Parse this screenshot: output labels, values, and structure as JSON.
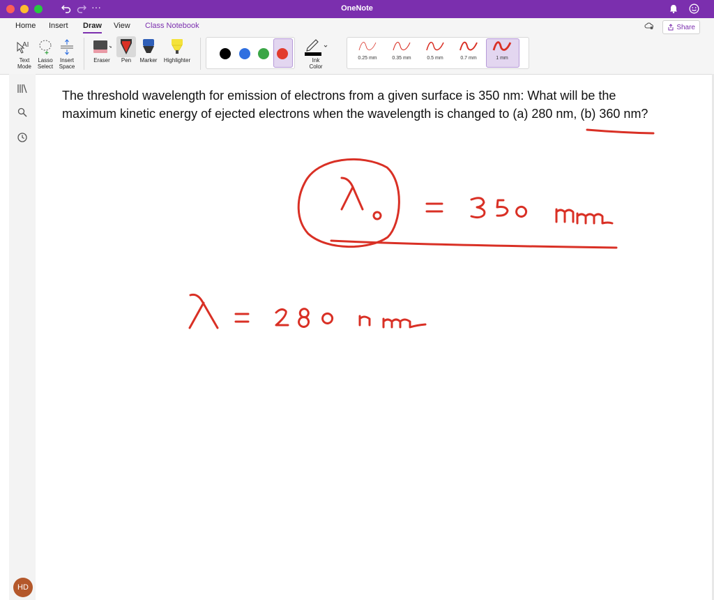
{
  "window": {
    "title": "OneNote",
    "colors": {
      "titlebar": "#7b2fae",
      "ink": "#d93025"
    }
  },
  "tabs": [
    "Home",
    "Insert",
    "Draw",
    "View",
    "Class Notebook"
  ],
  "active_tab": "Draw",
  "share_label": "Share",
  "ribbon": {
    "text_mode": [
      "Text",
      "Mode"
    ],
    "lasso_select": [
      "Lasso",
      "Select"
    ],
    "insert_space": [
      "Insert",
      "Space"
    ],
    "eraser": "Eraser",
    "pen": "Pen",
    "marker": "Marker",
    "highlighter": "Highlighter",
    "ink_color": [
      "Ink",
      "Color"
    ],
    "colors": [
      "#000000",
      "#2f6fe0",
      "#3aa646",
      "#e23b2e"
    ],
    "thickness": [
      "0.25 mm",
      "0.35 mm",
      "0.5 mm",
      "0.7 mm",
      "1 mm"
    ],
    "selected_thickness": "1 mm"
  },
  "page": {
    "question": "The threshold wavelength for emission of electrons from a given surface is 350 nm: What will be the maximum kinetic energy of ejected electrons when the wavelength is changed to (a) 280 nm, (b) 360 nm?"
  },
  "user": {
    "initials": "HD"
  }
}
